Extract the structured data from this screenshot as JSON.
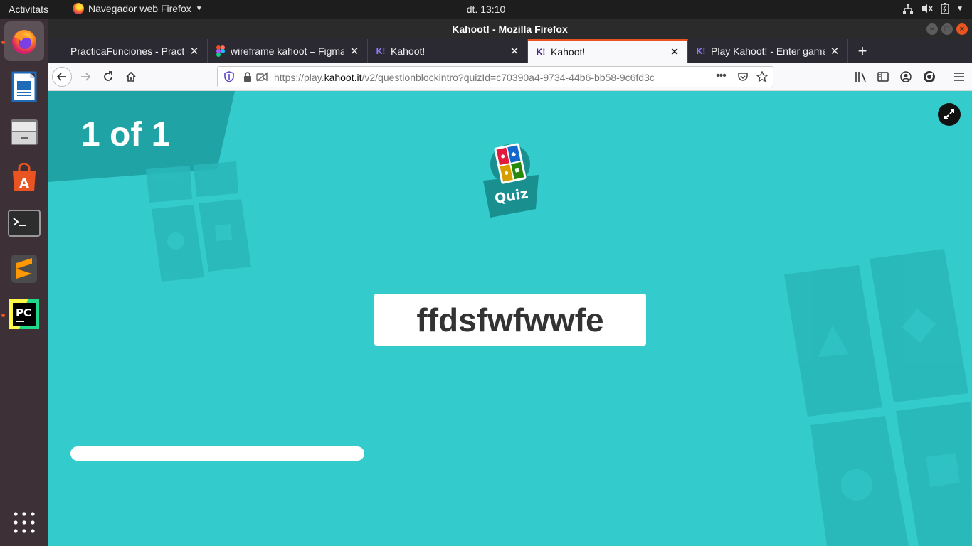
{
  "topbar": {
    "activities": "Activitats",
    "app_menu": "Navegador web Firefox",
    "clock": "dt. 13:10"
  },
  "window": {
    "title": "Kahoot! - Mozilla Firefox"
  },
  "tabs": [
    {
      "label": "PracticaFunciones - Practica",
      "icon": "docs-icon"
    },
    {
      "label": "wireframe kahoot – Figma",
      "icon": "figma-icon"
    },
    {
      "label": "Kahoot!",
      "icon": "kahoot-icon"
    },
    {
      "label": "Kahoot!",
      "icon": "kahoot-icon",
      "selected": true
    },
    {
      "label": "Play Kahoot! - Enter game",
      "icon": "kahoot-icon"
    }
  ],
  "url": {
    "prefix": "https://play.",
    "domain": "kahoot.it",
    "path": "/v2/questionblockintro?quizId=c70390a4-9734-44b6-bb58-9c6fd3c"
  },
  "content": {
    "counter": "1 of 1",
    "badge": "Quiz",
    "question": "ffdsfwfwwfe"
  },
  "colors": {
    "background": "#33cbcc",
    "dark_panel": "#1fa3a5",
    "accent": "#e95420"
  }
}
